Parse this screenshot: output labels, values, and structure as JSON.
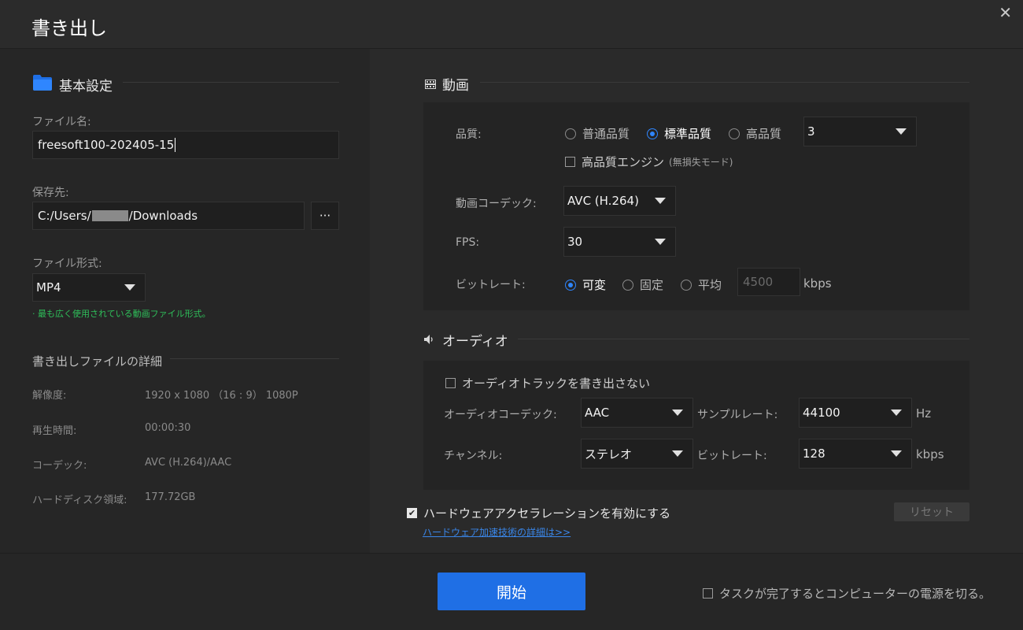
{
  "window": {
    "title": "書き出し",
    "close_glyph": "✕"
  },
  "basic": {
    "section_title": "基本設定",
    "filename_label": "ファイル名:",
    "filename_value": "freesoft100-202405-15",
    "save_label": "保存先:",
    "save_prefix": "C:/Users/",
    "save_suffix": "/Downloads",
    "browse_label": "···",
    "format_label": "ファイル形式:",
    "format_value": "MP4",
    "format_note": "· 最も広く使用されている動画ファイル形式。"
  },
  "details": {
    "section_title": "書き出しファイルの詳細",
    "rows": [
      {
        "label": "解像度:",
        "value": "1920 x 1080 （16 : 9） 1080P"
      },
      {
        "label": "再生時間:",
        "value": "00:00:30"
      },
      {
        "label": "コーデック:",
        "value": "AVC (H.264)/AAC"
      },
      {
        "label": "ハードディスク領域:",
        "value": "177.72GB"
      }
    ]
  },
  "video": {
    "section_title": "動画",
    "quality_label": "品質:",
    "quality_options": [
      "普通品質",
      "標準品質",
      "高品質"
    ],
    "quality_selected": "標準品質",
    "quality_level": "3",
    "hq_engine_label": "高品質エンジン",
    "hq_engine_note": "(無損失モード)",
    "codec_label": "動画コーデック:",
    "codec_value": "AVC (H.264)",
    "fps_label": "FPS:",
    "fps_value": "30",
    "bitrate_label": "ビットレート:",
    "bitrate_options": [
      "可変",
      "固定",
      "平均"
    ],
    "bitrate_selected": "可変",
    "bitrate_value": "4500",
    "bitrate_unit": "kbps"
  },
  "audio": {
    "section_title": "オーディオ",
    "no_audio_label": "オーディオトラックを書き出さない",
    "codec_label": "オーディオコーデック:",
    "codec_value": "AAC",
    "samplerate_label": "サンプルレート:",
    "samplerate_value": "44100",
    "samplerate_unit": "Hz",
    "channel_label": "チャンネル:",
    "channel_value": "ステレオ",
    "bitrate_label": "ビットレート:",
    "bitrate_value": "128",
    "bitrate_unit": "kbps"
  },
  "hardware": {
    "accel_label": "ハードウェアアクセラレーションを有効にする",
    "accel_link": "ハードウェア加速技術の詳細は>>",
    "reset_label": "リセット"
  },
  "footer": {
    "start_label": "開始",
    "shutdown_label": "タスクが完了するとコンピューターの電源を切る。"
  },
  "colors": {
    "accent": "#1f6fe5",
    "green": "#2fbf5a",
    "link": "#3a86e8"
  }
}
